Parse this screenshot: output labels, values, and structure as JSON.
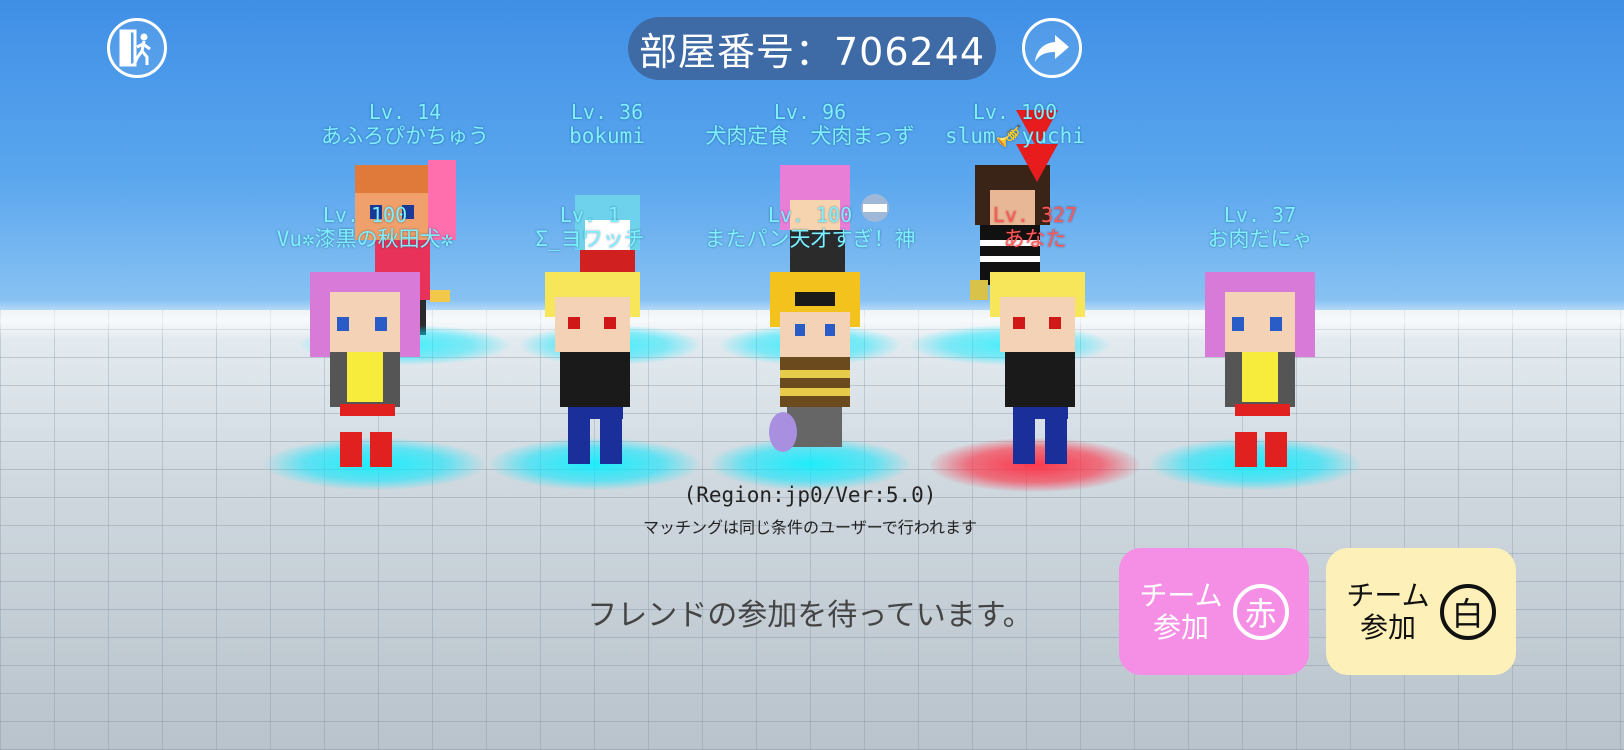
{
  "header": {
    "room_label": "部屋番号：706244",
    "exit_icon": "exit-door-icon",
    "share_icon": "share-arrow-icon"
  },
  "players_back": [
    {
      "level": "Lv. 14",
      "name": "あふろぴかちゅう"
    },
    {
      "level": "Lv. 36",
      "name": "bokumi"
    },
    {
      "level": "Lv. 96",
      "name": "犬肉定食　犬肉まっず"
    },
    {
      "level": "Lv. 100",
      "name": "slum🎺yuchi"
    }
  ],
  "players_front": [
    {
      "level": "Lv. 100",
      "name": "Vu✲漆黒の秋田犬✲",
      "team": "cyan"
    },
    {
      "level": "Lv. 1",
      "name": "Σ_ヨワッチ",
      "team": "cyan"
    },
    {
      "level": "Lv. 100",
      "name": "またパン天才すぎ！神",
      "team": "cyan"
    },
    {
      "level": "Lv. 327",
      "name": "あなた",
      "team": "red"
    },
    {
      "level": "Lv. 37",
      "name": "お肉だにゃ",
      "team": "cyan"
    }
  ],
  "info": {
    "region": "(Region:jp0/Ver:5.0)",
    "matching_note": "マッチングは同じ条件のユーザーで行われます",
    "waiting": "フレンドの参加を待っています。"
  },
  "team_buttons": {
    "red": {
      "line1": "チーム",
      "line2": "参加",
      "badge": "赤"
    },
    "white": {
      "line1": "チーム",
      "line2": "参加",
      "badge": "白"
    }
  },
  "colors": {
    "sky": "#4a98ea",
    "room_pill": "#3e6aa6",
    "name_cyan": "#7ff0ff",
    "name_self": "#ff5a5a",
    "team_red_button": "#f58fe5",
    "team_white_button": "#fdf0b8"
  }
}
